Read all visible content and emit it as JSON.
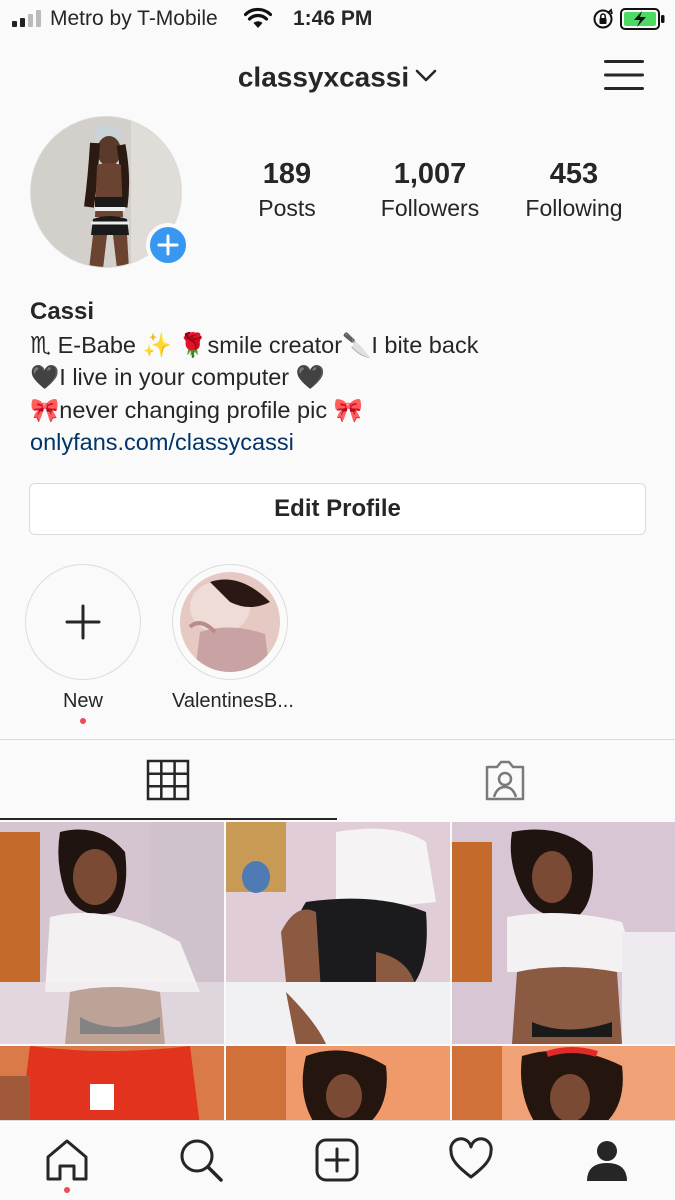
{
  "status_bar": {
    "carrier": "Metro by T-Mobile",
    "time": "1:46 PM",
    "signal_bars_filled": 2,
    "battery_state": "charging"
  },
  "header": {
    "username": "classyxcassi"
  },
  "profile": {
    "stats": [
      {
        "value": "189",
        "label": "Posts"
      },
      {
        "value": "1,007",
        "label": "Followers"
      },
      {
        "value": "453",
        "label": "Following"
      }
    ],
    "name": "Cassi",
    "bio_lines": [
      "♏ E-Babe ✨ 🌹smile creator🔪I bite back",
      "🖤I live in your computer 🖤",
      "🎀never changing profile pic 🎀"
    ],
    "link": "onlyfans.com/classycassi",
    "edit_button": "Edit Profile"
  },
  "highlights": [
    {
      "label": "New",
      "icon": "plus-icon",
      "has_dot": true
    },
    {
      "label": "ValentinesB...",
      "icon": "story-thumbnail"
    }
  ],
  "tabs": [
    {
      "name": "grid",
      "icon": "grid-icon",
      "active": true
    },
    {
      "name": "tagged",
      "icon": "tagged-icon",
      "active": false
    }
  ],
  "bottom_nav": [
    {
      "name": "home",
      "icon": "home-icon",
      "active": true
    },
    {
      "name": "search",
      "icon": "search-icon"
    },
    {
      "name": "new-post",
      "icon": "add-post-icon"
    },
    {
      "name": "activity",
      "icon": "heart-icon"
    },
    {
      "name": "profile",
      "icon": "profile-icon"
    }
  ],
  "colors": {
    "accent_blue": "#3897f0",
    "link_blue": "#003569",
    "notification_red": "#ed4956",
    "text": "#262626",
    "border": "#dbdbdb"
  }
}
